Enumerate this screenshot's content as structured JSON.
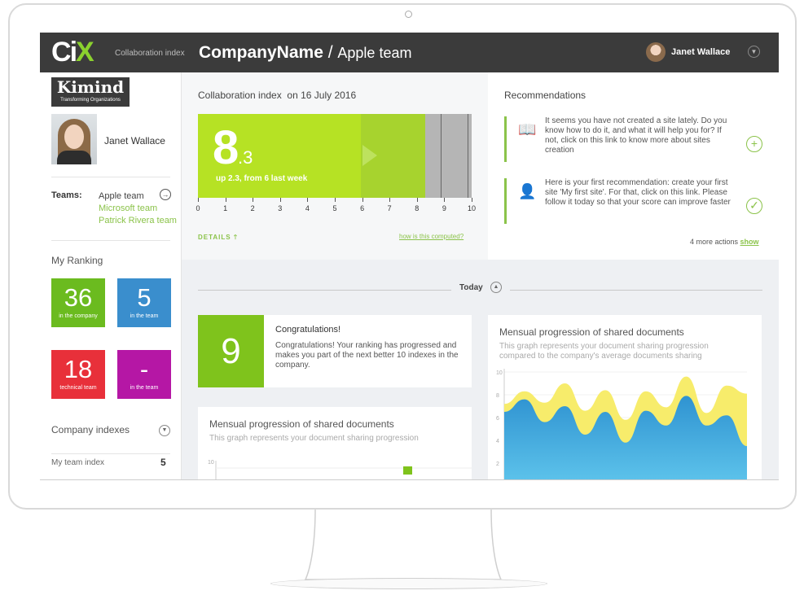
{
  "header": {
    "logo": "CIX",
    "logo_sub": "Collaboration index",
    "company": "CompanyName",
    "separator": " / ",
    "team": "Apple team",
    "user_name": "Janet Wallace"
  },
  "sidebar": {
    "org_logo": "Kimind",
    "org_tagline": "Transforming Organizations",
    "profile_name": "Janet Wallace",
    "teams_label": "Teams:",
    "teams": [
      {
        "label": "Apple team"
      },
      {
        "label": "Microsoft team"
      },
      {
        "label": "Patrick Rivera team"
      }
    ],
    "ranking_title": "My Ranking",
    "rankings": [
      {
        "value": "36",
        "caption": "in the company",
        "color": "#6bbb1f"
      },
      {
        "value": "5",
        "caption": "in the team",
        "color": "#3a8ecd"
      },
      {
        "value": "18",
        "caption": "technical team",
        "color": "#e8303a"
      },
      {
        "value": "-",
        "caption": "in the team",
        "color": "#b517a5"
      }
    ],
    "company_indexes_title": "Company indexes",
    "my_team_index_label": "My team index",
    "my_team_index_value": "5"
  },
  "collaboration": {
    "title": "Collaboration index",
    "date": "on 16 July 2016",
    "score_int": "8",
    "score_dec": ".3",
    "score": 8.3,
    "delta": "up 2.3, from 6 last week",
    "scale": [
      "0",
      "1",
      "2",
      "3",
      "4",
      "5",
      "6",
      "7",
      "8",
      "9",
      "10"
    ],
    "details_label": "DETAILS",
    "computed_link": "how is this computed?"
  },
  "recommendations": {
    "title": "Recommendations",
    "items": [
      {
        "text": "It seems you have not created a site lately. Do you know how to do it, and what it will help you for? If not, click on this link to know more about sites creation",
        "action": "+"
      },
      {
        "text": "Here is your first recommendation: create your first site 'My first site'. For that, click on this link. Please follow it today so that your score can improve faster",
        "action": "✓"
      }
    ],
    "more_actions": "4 more actions",
    "show_label": "show"
  },
  "today": {
    "label": "Today"
  },
  "congrats": {
    "number": "9",
    "title": "Congratulations!",
    "text": "Congratulations! Your ranking has progressed and makes you part of the next better 10 indexes in the company."
  },
  "chart_small": {
    "title": "Mensual progression of shared documents",
    "subtitle": "This graph represents your document sharing progression",
    "y_tick": "10"
  },
  "chart_data": {
    "type": "area",
    "title": "Mensual progression of shared documents",
    "subtitle": "This graph represents your document sharing progression compared to the company's average documents sharing",
    "ylim": [
      0,
      10
    ],
    "yticks": [
      "10",
      "8",
      "6",
      "4",
      "2"
    ],
    "series": [
      {
        "color": "#f7ec6b",
        "values": [
          7.2,
          8.3,
          7.3,
          9.0,
          6.6,
          8.4,
          5.8,
          8.3,
          6.9,
          9.6,
          6.4,
          8.8,
          8.1
        ]
      },
      {
        "color": "#2f93d1",
        "values": [
          6.5,
          7.6,
          5.6,
          7.0,
          4.5,
          6.5,
          3.8,
          6.6,
          5.3,
          7.9,
          5.3,
          6.2,
          3.5
        ]
      }
    ]
  }
}
